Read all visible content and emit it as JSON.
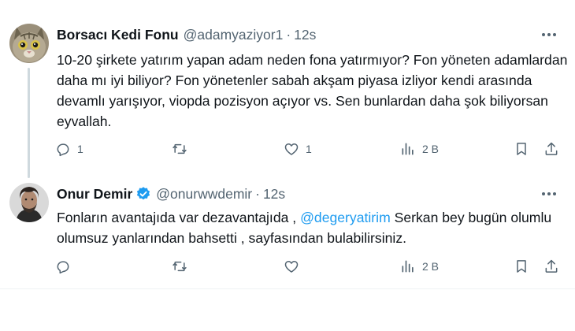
{
  "tweets": [
    {
      "author_name": "Borsacı Kedi Fonu",
      "handle": "@adamyaziyor1",
      "separator": "·",
      "time": "12s",
      "avatar_icon": "cat-avatar",
      "text": "10-20 şirkete yatırım yapan adam neden fona yatırmıyor? Fon yöneten adamlardan daha mı iyi biliyor? Fon yönetenler sabah akşam piyasa izliyor kendi arasında devamlı yarışıyor, viopda pozisyon açıyor vs. Sen bunlardan daha şok biliyorsan eyvallah.",
      "actions": {
        "replies": "1",
        "retweets": "",
        "likes": "1",
        "views": "2 B"
      }
    },
    {
      "author_name": "Onur Demir",
      "verified": true,
      "handle": "@onurwwdemir",
      "separator": "·",
      "time": "12s",
      "avatar_icon": "person-avatar",
      "text_before": "Fonların avantajıda var dezavantajıda , ",
      "mention": "@degeryatirim",
      "text_after": " Serkan bey bugün olumlu olumsuz yanlarından bahsetti , sayfasından bulabilirsiniz.",
      "actions": {
        "replies": "",
        "retweets": "",
        "likes": "",
        "views": "2 B"
      }
    }
  ],
  "colors": {
    "text": "#0f1419",
    "secondary": "#536471",
    "link": "#1d9bf0",
    "verified": "#1d9bf0",
    "divider": "#eff3f4"
  }
}
